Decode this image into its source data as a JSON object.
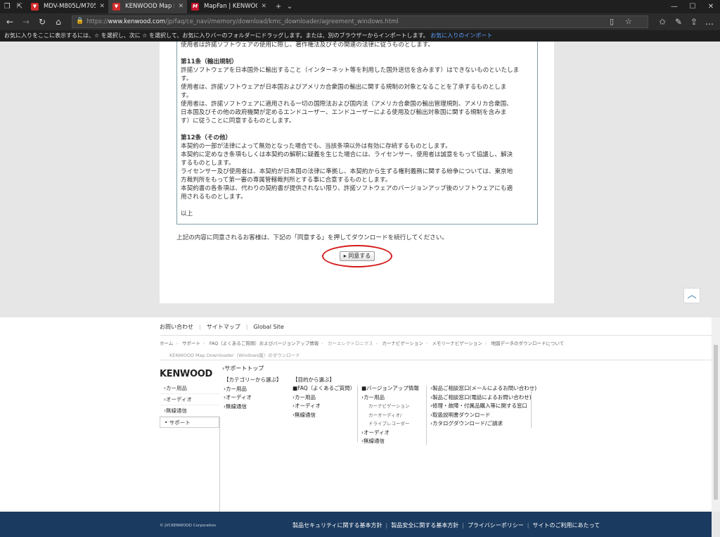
{
  "browser": {
    "tabs": [
      {
        "title": "MDV-M805L/M705W/M705",
        "active": false
      },
      {
        "title": "KENWOOD Map Downl",
        "active": true
      },
      {
        "title": "MapFan | KENWOOD MapF",
        "active": false
      }
    ],
    "url_prefix": "https://",
    "url_domain": "www.kenwood.com",
    "url_path": "/jp/faq/ce_navi/memory/download/kmc_downloader/agreement_windows.html",
    "favbar_text": "お気に入りをここに表示するには、☆ を選択し、次に ☆ を選択して、お気に入りバーのフォルダーにドラッグします。または、別のブラウザーからインポートします。",
    "favbar_link": "お気に入りのインポート"
  },
  "license": {
    "line_top": "使用者は許諾ソフトウェアの使用に際し、著作権法及びその関連の法律に従うものとします。",
    "art11_title": "第11条（輸出規制）",
    "art11_lines": [
      "許諾ソフトウェアを日本国外に輸出すること（インターネット等を利用した国外送信を含みます）はできないものといたしま",
      "す。",
      "使用者は、許諾ソフトウェアが日本国およびアメリカ合衆国の輸出に関する規制の対象となることを了承するものとしま",
      "す。",
      "使用者は、許諾ソフトウェアに適用される一切の国際法および国内法（アメリカ合衆国の輸出管理規則、アメリカ合衆国、",
      "日本国及びその他の政府機関が定めるエンドユーザー、エンドユーザーによる使用及び輸出対象国に関する規制を含みま",
      "す）に従うことに同意するものとします。"
    ],
    "art12_title": "第12条（その他）",
    "art12_lines": [
      "本契約の一部が法律によって無効となった場合でも、当該条項以外は有効に存続するものとします。",
      "本契約に定めなき条項もしくは本契約の解釈に疑義を生じた場合には、ライセンサー、使用者は誠意をもって協議し、解決",
      "するものとします。",
      "ライセンサー及び使用者は、本契約が日本国の法律に準拠し、本契約から生ずる権利義務に関する紛争については、東京地",
      "方裁判所をもって第一審の専属管轄裁判所とする事に合意するものとします。",
      "本契約書の各条項は、代わりの契約書が提供されない限り、許諾ソフトウェアのバージョンアップ後のソフトウェアにも適",
      "用されるものとします。"
    ],
    "end": "以上"
  },
  "agree_text": "上記の内容に同意されるお客様は、下記の「同意する」を押してダウンロードを続行してください。",
  "agree_button": "▸ 同意する",
  "footer": {
    "links": [
      "お問い合わせ",
      "サイトマップ",
      "Global Site"
    ],
    "breadcrumbs": [
      "ホーム",
      "サポート",
      "FAQ（よくあるご質問）およびバージョンアップ情報",
      "カーエレクトロニクス",
      "カーナビゲーション",
      "メモリーナビゲーション",
      "地図データのダウンロードについて"
    ],
    "breadcrumb_last": "KENWOOD Map Downloader（Windows版）のダウンロード",
    "logo": "KENWOOD",
    "side_menu": [
      "›カー用品",
      "›オーディオ",
      "›無線通信",
      "• サポート"
    ],
    "support_top": "›サポートトップ",
    "col_category": {
      "head": "【カテゴリーから選ぶ】",
      "items": [
        "›カー用品",
        "›オーディオ",
        "›無線通信"
      ]
    },
    "col_purpose_head": "【目的から選ぶ】",
    "col_faq": {
      "head": "■FAQ（よくあるご質問）",
      "items": [
        "›カー用品",
        "›オーディオ",
        "›無線通信"
      ]
    },
    "col_version": {
      "head": "■バージョンアップ情報",
      "items": [
        "›カー用品"
      ],
      "subs": [
        "カーナビゲーション",
        "カーオーディオ/",
        "ドライブレコーダー"
      ],
      "items2": [
        "›オーディオ",
        "›無線通信"
      ]
    },
    "col_contact": [
      "製品ご相談窓口(メールによるお問い合わせ)",
      "製品ご相談窓口(電話によるお問い合わせ)",
      "修理・故障・付属品購入等に関する窓口",
      "取扱説明書ダウンロード",
      "カタログダウンロード/ご請求"
    ],
    "copyright": "© JVCKENWOOD Corporation",
    "bottom_links": [
      "製品セキュリティに関する基本方針",
      "製品安全に関する基本方針",
      "プライバシーポリシー",
      "サイトのご利用にあたって"
    ]
  }
}
